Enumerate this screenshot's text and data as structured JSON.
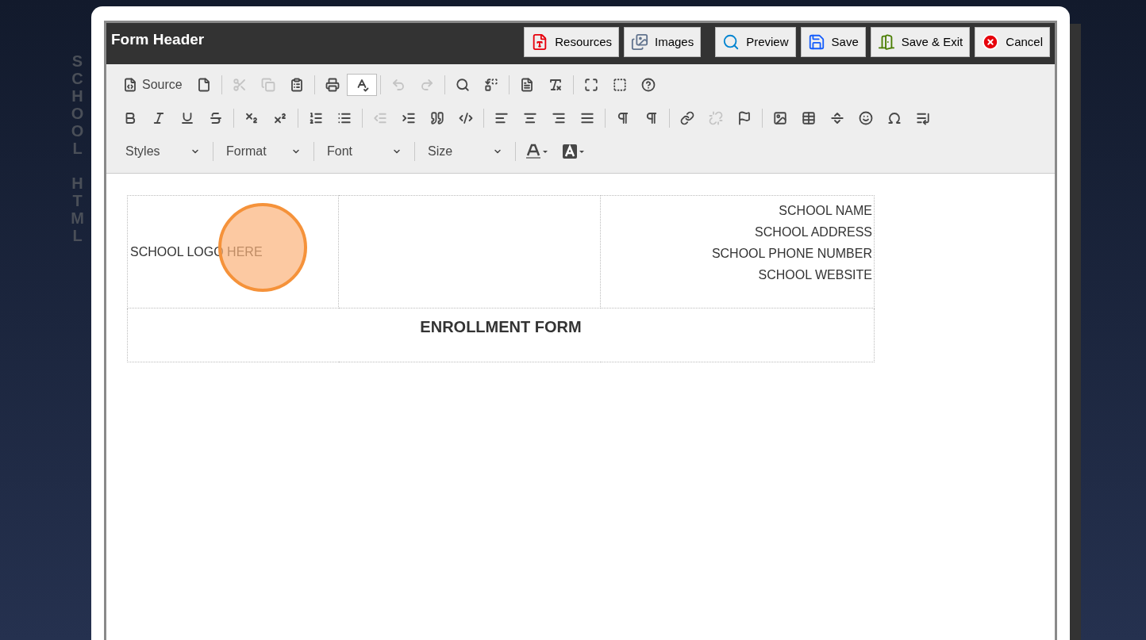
{
  "side_label": {
    "words": [
      "SCHOOL",
      "HTML"
    ]
  },
  "window": {
    "title": "Form Header"
  },
  "header_buttons": [
    {
      "kind": "pdf",
      "label": "Resources"
    },
    {
      "kind": "images",
      "label": "Images"
    },
    {
      "kind": "preview",
      "label": "Preview"
    },
    {
      "kind": "save",
      "label": "Save"
    },
    {
      "kind": "exit",
      "label": "Save & Exit"
    },
    {
      "kind": "cancel",
      "label": "Cancel"
    }
  ],
  "toolbar_rows": [
    [
      {
        "label": "Source",
        "disabled": false
      },
      {
        "disabled": false
      },
      {
        "disabled": true
      },
      {
        "disabled": true
      },
      {
        "disabled": false
      },
      {
        "disabled": false
      },
      {
        "disabled": false
      },
      {
        "disabled": true
      },
      {
        "disabled": true
      },
      {
        "disabled": false
      },
      {
        "disabled": false
      },
      {
        "disabled": false
      },
      {
        "disabled": false
      },
      {
        "disabled": false
      },
      {
        "disabled": false
      },
      {
        "disabled": false
      }
    ],
    [
      {
        "disabled": false
      },
      {
        "disabled": false
      },
      {
        "disabled": false
      },
      {
        "disabled": false
      },
      {
        "disabled": false
      },
      {
        "disabled": false
      },
      {
        "disabled": false
      },
      {
        "disabled": false
      },
      {
        "disabled": true
      },
      {
        "disabled": false
      },
      {
        "disabled": false
      },
      {
        "disabled": false
      },
      {
        "disabled": false
      },
      {
        "disabled": false
      },
      {
        "disabled": false
      },
      {
        "disabled": false
      },
      {
        "disabled": false
      },
      {
        "disabled": false
      },
      {
        "disabled": false
      },
      {
        "disabled": true
      },
      {
        "disabled": false
      },
      {
        "disabled": false
      },
      {
        "disabled": false
      },
      {
        "disabled": false
      },
      {
        "disabled": false
      },
      {
        "disabled": false
      },
      {
        "disabled": false
      }
    ]
  ],
  "combos": [
    "Styles",
    "Format",
    "Font",
    "Size"
  ],
  "document": {
    "logo_placeholder": "SCHOOL LOGO HERE",
    "school_lines": [
      "SCHOOL NAME",
      "SCHOOL ADDRESS",
      "SCHOOL PHONE NUMBER",
      "SCHOOL WEBSITE"
    ],
    "form_title": "ENROLLMENT FORM"
  }
}
